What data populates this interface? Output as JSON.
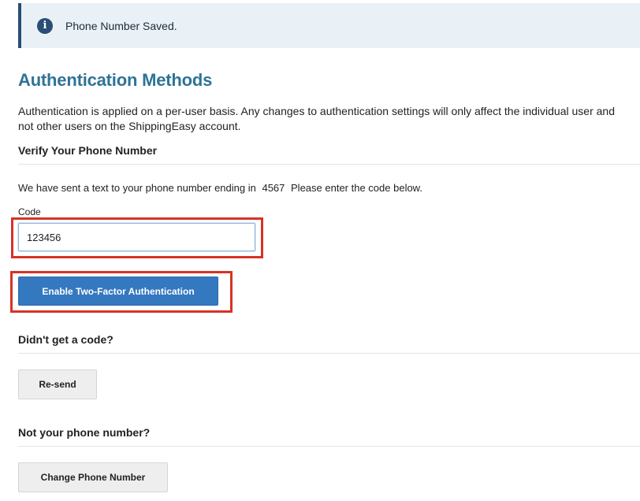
{
  "alert": {
    "icon": "info-icon",
    "icon_glyph": "i",
    "message": "Phone Number Saved."
  },
  "page": {
    "title": "Authentication Methods",
    "intro": "Authentication is applied on a per-user basis. Any changes to authentication settings will only affect the individual user and not other users on the ShippingEasy account."
  },
  "verify": {
    "heading": "Verify Your Phone Number",
    "sent_text_before": "We have sent a text to your phone number ending in",
    "phone_last_digits": "4567",
    "sent_text_after": "Please enter the code below.",
    "code_label": "Code",
    "code_value": "123456",
    "enable_button": "Enable Two-Factor Authentication"
  },
  "resend": {
    "heading": "Didn't get a code?",
    "button": "Re-send"
  },
  "change_phone": {
    "heading": "Not your phone number?",
    "button": "Change Phone Number"
  },
  "colors": {
    "title": "#2f7396",
    "primary_button": "#3478c0",
    "alert_background": "#e9f1f7",
    "alert_accent": "#2a4e74",
    "highlight": "#d63325"
  }
}
